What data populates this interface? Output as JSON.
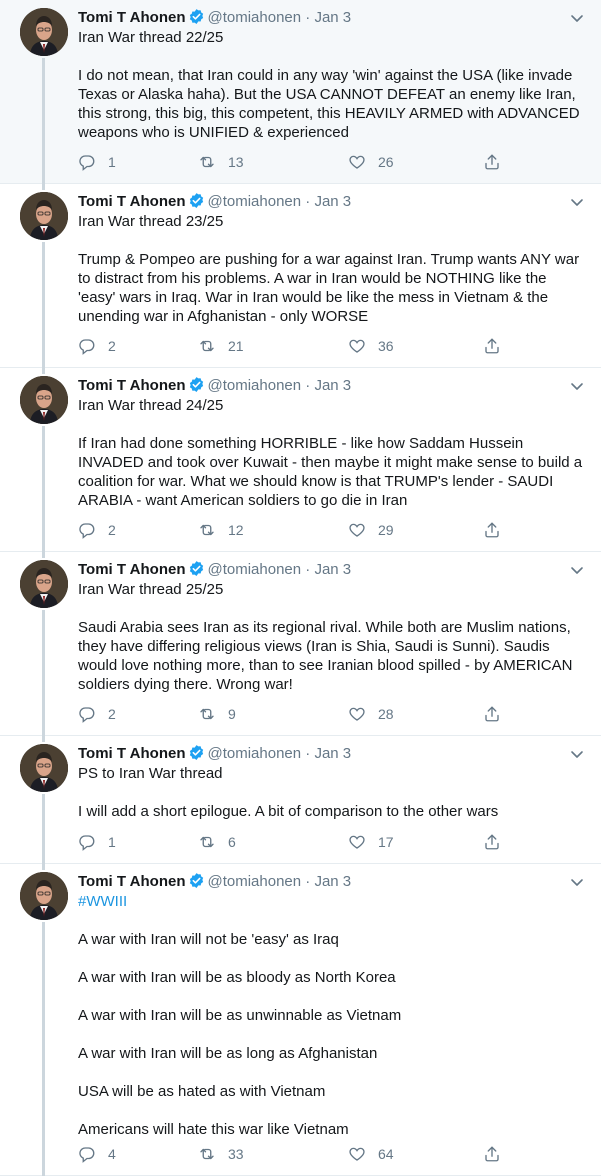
{
  "author": {
    "name": "Tomi T Ahonen",
    "handle": "@tomiahonen",
    "separator": "·"
  },
  "tweets": [
    {
      "date": "Jan 3",
      "paragraphs": [
        "Iran War thread 22/25",
        "I do not mean, that Iran could in any way 'win' against the USA (like invade Texas or Alaska haha). But the USA CANNOT DEFEAT an enemy like Iran, this strong, this big, this competent, this HEAVILY ARMED with ADVANCED weapons who is UNIFIED & experienced"
      ],
      "replies": "1",
      "retweets": "13",
      "likes": "26"
    },
    {
      "date": "Jan 3",
      "paragraphs": [
        "Iran War thread 23/25",
        "Trump & Pompeo are pushing for a war against Iran. Trump wants ANY war to distract from his problems. A war in Iran would be NOTHING like the 'easy' wars in Iraq. War in Iran would be like the mess in Vietnam & the unending war in Afghanistan - only WORSE"
      ],
      "replies": "2",
      "retweets": "21",
      "likes": "36"
    },
    {
      "date": "Jan 3",
      "paragraphs": [
        "Iran War thread 24/25",
        "If Iran had done something HORRIBLE - like how Saddam Hussein INVADED and took over Kuwait - then maybe it might make sense to build a coalition for war. What we should know is that TRUMP's lender - SAUDI ARABIA - want American soldiers to go die in Iran"
      ],
      "replies": "2",
      "retweets": "12",
      "likes": "29"
    },
    {
      "date": "Jan 3",
      "paragraphs": [
        "Iran War thread 25/25",
        "Saudi Arabia sees Iran as its regional rival. While both are Muslim nations, they have differing religious views (Iran is Shia, Saudi is Sunni). Saudis would love nothing more, than to see Iranian blood spilled - by AMERICAN soldiers dying there. Wrong war!"
      ],
      "replies": "2",
      "retweets": "9",
      "likes": "28"
    },
    {
      "date": "Jan 3",
      "paragraphs": [
        "PS to Iran War thread",
        "I will add a short epilogue. A bit of comparison to the other wars"
      ],
      "replies": "1",
      "retweets": "6",
      "likes": "17"
    },
    {
      "date": "Jan 3",
      "hashtag": "#WWIII",
      "paragraphs": [
        "A war with Iran will not be 'easy' as Iraq",
        "A war with Iran will be as bloody as North Korea",
        "A war with Iran will be as unwinnable as Vietnam",
        "A war with Iran will be as long as Afghanistan",
        "USA will be as hated as with Vietnam",
        "Americans will hate this war like Vietnam"
      ],
      "replies": "4",
      "retweets": "33",
      "likes": "64"
    }
  ],
  "colors": {
    "text": "#14171a",
    "muted": "#657786",
    "link": "#1b95e0",
    "verified": "#1da1f2",
    "thread_line": "#ccd6dd",
    "highlight_bg": "#f5f8fa"
  },
  "icons": {
    "reply": "reply-icon",
    "retweet": "retweet-icon",
    "like": "like-icon",
    "share": "share-icon",
    "caret": "chevron-down-icon",
    "verified": "verified-badge-icon"
  }
}
